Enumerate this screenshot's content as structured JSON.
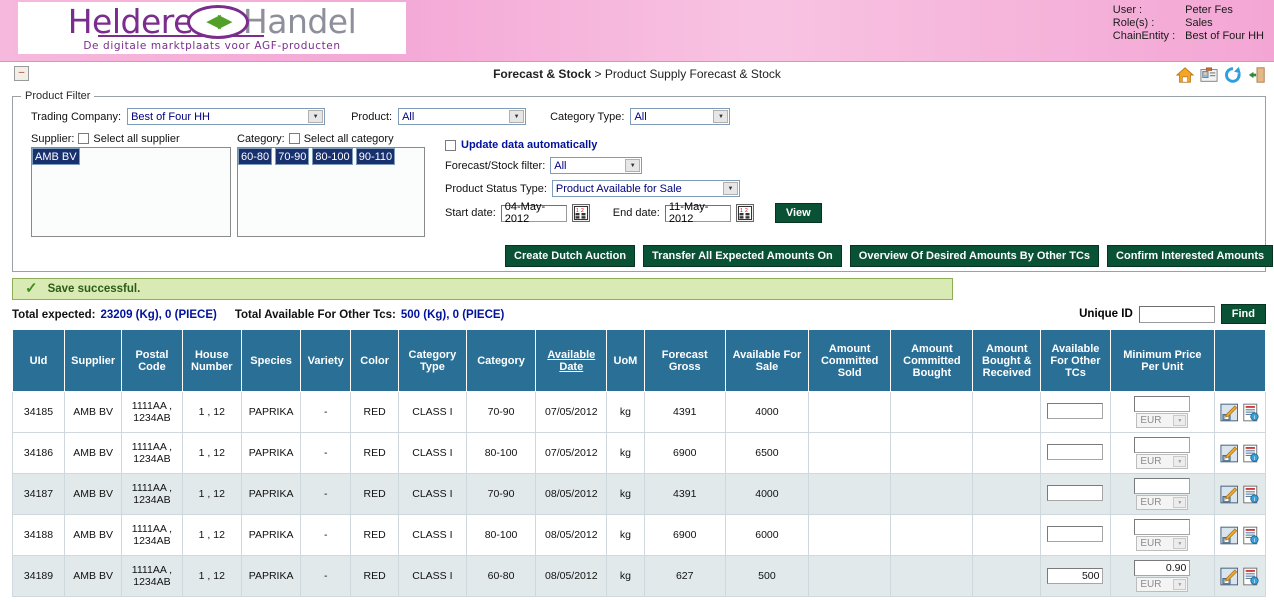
{
  "header": {
    "logo": {
      "word1": "Heldere",
      "word2": "Handel",
      "tagline": "De digitale marktplaats voor AGF-producten",
      "arrows": "◀▶"
    },
    "user_label": "User :",
    "user_value": "Peter Fes",
    "roles_label": "Role(s)  :",
    "roles_value": "Sales",
    "chain_label": "ChainEntity  :",
    "chain_value": "Best of Four HH",
    "icons": [
      "home-icon",
      "profile-card-icon",
      "refresh-icon",
      "logout-icon"
    ]
  },
  "breadcrumb": {
    "collapse_symbol": "–",
    "parent": "Forecast & Stock",
    "separator": " > ",
    "current": "Product Supply Forecast & Stock"
  },
  "filter": {
    "legend": "Product Filter",
    "trading_company_label": "Trading Company:",
    "trading_company_value": "Best of Four HH",
    "product_label": "Product:",
    "product_value": "All",
    "category_type_label": "Category Type:",
    "category_type_value": "All",
    "supplier_label": "Supplier:",
    "select_all_supplier_label": "Select all supplier",
    "supplier_options": [
      "AMB BV"
    ],
    "category_label": "Category:",
    "select_all_category_label": "Select all category",
    "category_options": [
      "60-80",
      "70-90",
      "80-100",
      "90-110"
    ],
    "update_auto_label": "Update data automatically",
    "forecast_filter_label": "Forecast/Stock filter:",
    "forecast_filter_value": "All",
    "status_type_label": "Product Status Type:",
    "status_type_value": "Product Available for Sale",
    "start_date_label": "Start date:",
    "start_date_value": "04-May-2012",
    "end_date_label": "End date:",
    "end_date_value": "11-May-2012",
    "view_button": "View",
    "action_buttons": [
      "Create Dutch Auction",
      "Transfer All Expected Amounts On",
      "Overview Of Desired Amounts By Other TCs",
      "Confirm Interested Amounts"
    ]
  },
  "notification": {
    "icon": "check-icon",
    "message": "Save successful."
  },
  "totals": {
    "expected_label": "Total expected:",
    "expected_value": "23209 (Kg), 0 (PIECE)",
    "available_label": "Total Available For Other Tcs:",
    "available_value": "500 (Kg), 0 (PIECE)",
    "unique_id_label": "Unique ID",
    "unique_id_value": "",
    "find_button": "Find"
  },
  "table": {
    "columns": [
      "UId",
      "Supplier",
      "Postal Code",
      "House Number",
      "Species",
      "Variety",
      "Color",
      "Category Type",
      "Category",
      "Available Date",
      "UoM",
      "Forecast Gross",
      "Available For Sale",
      "Amount Committed Sold",
      "Amount Committed Bought",
      "Amount Bought & Received",
      "Available For Other TCs",
      "Minimum Price Per Unit",
      ""
    ],
    "sorted_column": "Available Date",
    "currency": "EUR",
    "rows": [
      {
        "uid": "34185",
        "supplier": "AMB BV",
        "postal_code": "1111AA , 1234AB",
        "house_number": "1 , 12",
        "species": "PAPRIKA",
        "variety": "-",
        "color": "RED",
        "category_type": "CLASS I",
        "category": "70-90",
        "available_date": "07/05/2012",
        "uom": "kg",
        "forecast_gross": "4391",
        "available_for_sale": "4000",
        "amount_committed_sold": "",
        "amount_committed_bought": "",
        "amount_bought_received": "",
        "available_other_tcs": "",
        "min_price": ""
      },
      {
        "uid": "34186",
        "supplier": "AMB BV",
        "postal_code": "1111AA , 1234AB",
        "house_number": "1 , 12",
        "species": "PAPRIKA",
        "variety": "-",
        "color": "RED",
        "category_type": "CLASS I",
        "category": "80-100",
        "available_date": "07/05/2012",
        "uom": "kg",
        "forecast_gross": "6900",
        "available_for_sale": "6500",
        "amount_committed_sold": "",
        "amount_committed_bought": "",
        "amount_bought_received": "",
        "available_other_tcs": "",
        "min_price": ""
      },
      {
        "uid": "34187",
        "supplier": "AMB BV",
        "postal_code": "1111AA , 1234AB",
        "house_number": "1 , 12",
        "species": "PAPRIKA",
        "variety": "-",
        "color": "RED",
        "category_type": "CLASS I",
        "category": "70-90",
        "available_date": "08/05/2012",
        "uom": "kg",
        "forecast_gross": "4391",
        "available_for_sale": "4000",
        "amount_committed_sold": "",
        "amount_committed_bought": "",
        "amount_bought_received": "",
        "available_other_tcs": "",
        "min_price": ""
      },
      {
        "uid": "34188",
        "supplier": "AMB BV",
        "postal_code": "1111AA , 1234AB",
        "house_number": "1 , 12",
        "species": "PAPRIKA",
        "variety": "-",
        "color": "RED",
        "category_type": "CLASS I",
        "category": "80-100",
        "available_date": "08/05/2012",
        "uom": "kg",
        "forecast_gross": "6900",
        "available_for_sale": "6000",
        "amount_committed_sold": "",
        "amount_committed_bought": "",
        "amount_bought_received": "",
        "available_other_tcs": "",
        "min_price": ""
      },
      {
        "uid": "34189",
        "supplier": "AMB BV",
        "postal_code": "1111AA , 1234AB",
        "house_number": "1 , 12",
        "species": "PAPRIKA",
        "variety": "-",
        "color": "RED",
        "category_type": "CLASS I",
        "category": "60-80",
        "available_date": "08/05/2012",
        "uom": "kg",
        "forecast_gross": "627",
        "available_for_sale": "500",
        "amount_committed_sold": "",
        "amount_committed_bought": "",
        "amount_bought_received": "",
        "available_other_tcs": "500",
        "min_price": "0.90"
      }
    ]
  },
  "colors": {
    "banner_pink": "#f4a8d6",
    "logo_purple": "#7b2d8e",
    "table_header_blue": "#2a6f96",
    "button_green": "#0a5236",
    "link_blue": "#00119e",
    "list_select_navy": "#19306e",
    "success_bg": "#d9eab5"
  }
}
